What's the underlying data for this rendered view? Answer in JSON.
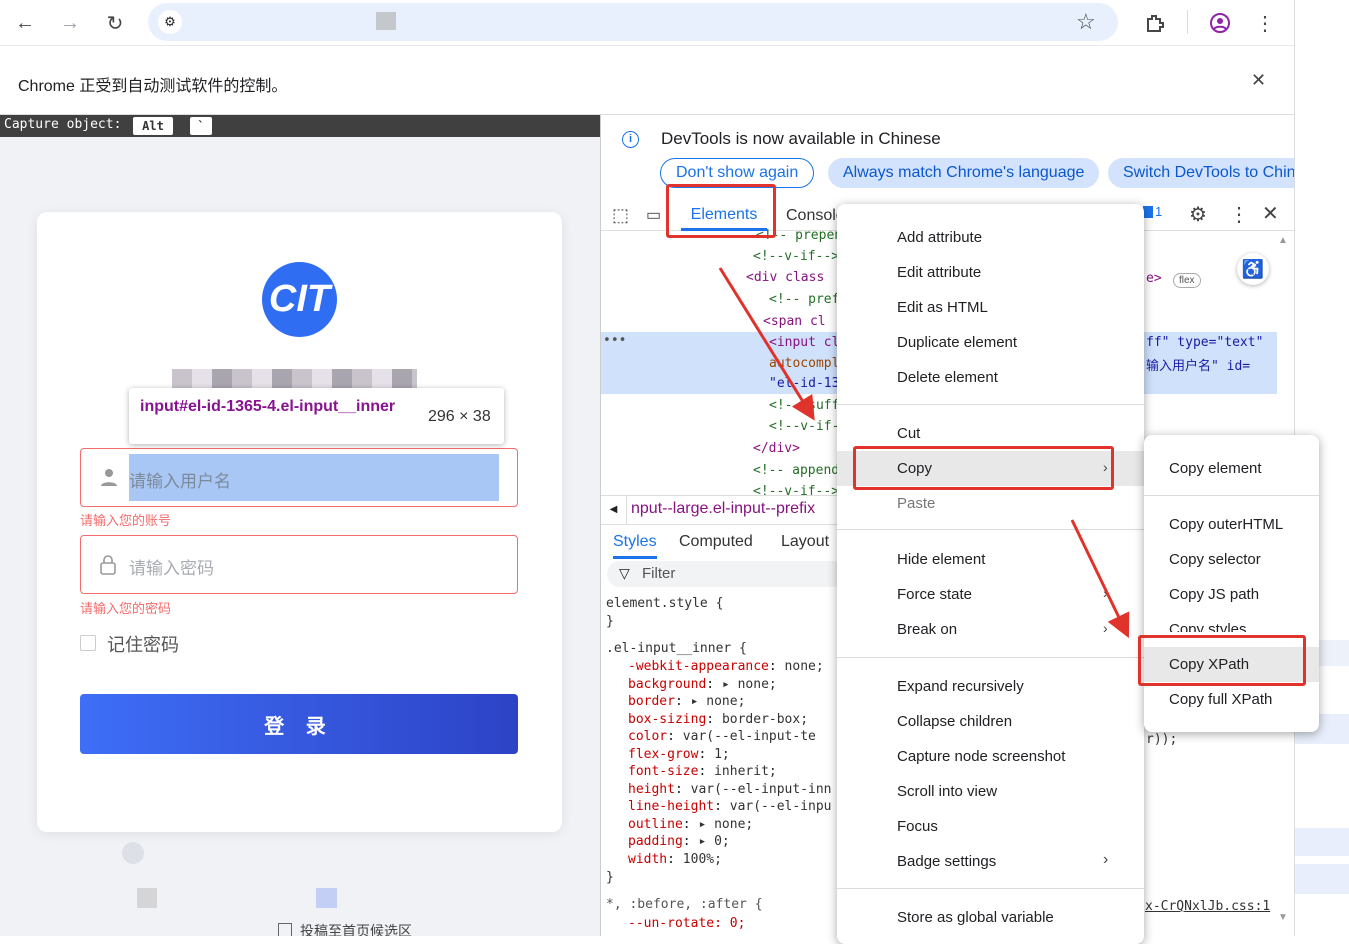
{
  "browser": {
    "banner_text": "Chrome 正受到自动测试软件的控制。",
    "close_glyph": "✕"
  },
  "capture": {
    "label": "Capture object:",
    "key1": "Alt",
    "key2": "`"
  },
  "login": {
    "logo_text": "CIT",
    "username_placeholder": "请输入用户名",
    "username_error": "请输入您的账号",
    "password_placeholder": "请输入密码",
    "password_error": "请输入您的密码",
    "remember_label": "记住密码",
    "login_button": "登 录",
    "bottom_text": "投稿至首页候选区"
  },
  "inspect_tooltip": {
    "selector": "input#el-id-1365-4.el-input__inner",
    "size": "296 × 38"
  },
  "devtools": {
    "notice": "DevTools is now available in Chinese",
    "btn_dont_show": "Don't show again",
    "btn_always_match": "Always match Chrome's language",
    "btn_switch": "Switch DevTools to Chin",
    "tabs": [
      "Elements",
      "Console"
    ],
    "issues_count": "1",
    "dom_lines": [
      "<!-- prepen",
      "<!--v-if-->",
      "<div class",
      "<!-- pref",
      "<span cl",
      "<input cl",
      "autocompl",
      "\"el-id-13",
      "<!-- suff",
      "<!--v-if-",
      "</div>",
      "<!-- append",
      "<!--v-if-->"
    ],
    "dom_right": [
      "e> ",
      "ff\" type=\"text\"",
      "输入用户名\" id=",
      "r));"
    ],
    "flex_badge": "flex",
    "breadcrumb": "nput--large.el-input--prefix",
    "style_tabs": [
      "Styles",
      "Computed",
      "Layout"
    ],
    "filter_placeholder": "Filter",
    "element_style": "element.style {",
    "rule_selector": ".el-input__inner {",
    "css_props": [
      [
        "-webkit-appearance",
        "none;"
      ],
      [
        "background",
        "▸ none;"
      ],
      [
        "border",
        "▸ none;"
      ],
      [
        "box-sizing",
        "border-box;"
      ],
      [
        "color",
        "var(--el-input-te"
      ],
      [
        "flex-grow",
        "1;"
      ],
      [
        "font-size",
        "inherit;"
      ],
      [
        "height",
        "var(--el-input-inn"
      ],
      [
        "line-height",
        "var(--el-inpu"
      ],
      [
        "outline",
        "▸ none;"
      ],
      [
        "padding",
        "▸ 0;"
      ],
      [
        "width",
        "100%;"
      ]
    ],
    "close_brace": "}",
    "after_selector": "*, :before, :after {",
    "after_prop": "--un-rotate: 0;",
    "css_file": "x-CrQNxlJb.css:1"
  },
  "context_menu": {
    "items": [
      "Add attribute",
      "Edit attribute",
      "Edit as HTML",
      "Duplicate element",
      "Delete element",
      "Cut",
      "Copy",
      "Paste",
      "Hide element",
      "Force state",
      "Break on",
      "Expand recursively",
      "Collapse children",
      "Capture node screenshot",
      "Scroll into view",
      "Focus",
      "Badge settings",
      "Store as global variable"
    ]
  },
  "copy_submenu": {
    "items": [
      "Copy element",
      "Copy outerHTML",
      "Copy selector",
      "Copy JS path",
      "Copy styles",
      "Copy XPath",
      "Copy full XPath"
    ]
  },
  "colors": {
    "accent": "#1a73e8",
    "highlight_red": "#e0332b",
    "error": "#f56c6c"
  }
}
